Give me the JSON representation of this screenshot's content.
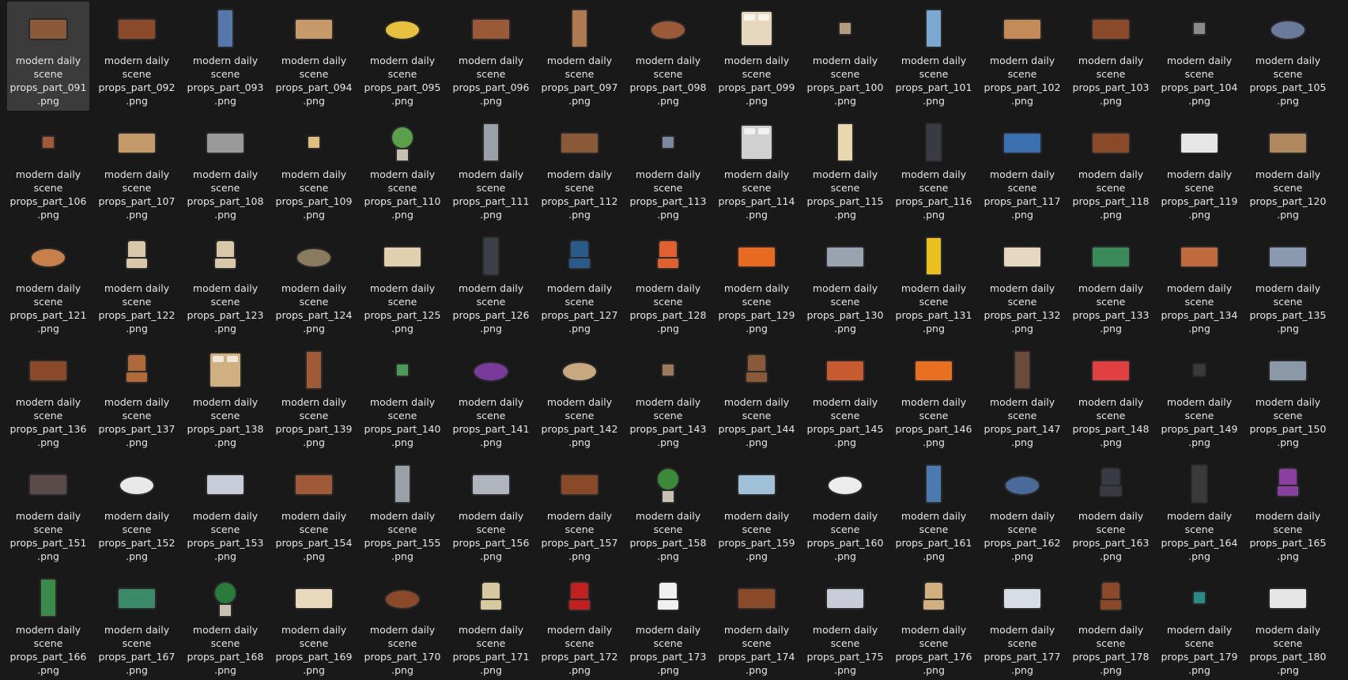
{
  "files": [
    {
      "name_line1": "modern daily",
      "name_line2": "scene",
      "name_line3": "props_part_091",
      "name_line4": ".png",
      "icon": "sofa-icon",
      "color": "#8a5a3a"
    },
    {
      "name_line1": "modern daily",
      "name_line2": "scene",
      "name_line3": "props_part_092",
      "name_line4": ".png",
      "icon": "bench-icon",
      "color": "#8a4a2a"
    },
    {
      "name_line1": "modern daily",
      "name_line2": "scene",
      "name_line3": "props_part_093",
      "name_line4": ".png",
      "icon": "parking-meter-icon",
      "color": "#5577aa"
    },
    {
      "name_line1": "modern daily",
      "name_line2": "scene",
      "name_line3": "props_part_094",
      "name_line4": ".png",
      "icon": "rug-icon",
      "color": "#c89a6a"
    },
    {
      "name_line1": "modern daily",
      "name_line2": "scene",
      "name_line3": "props_part_095",
      "name_line4": ".png",
      "icon": "stool-icon",
      "color": "#e8c040"
    },
    {
      "name_line1": "modern daily",
      "name_line2": "scene",
      "name_line3": "props_part_096",
      "name_line4": ".png",
      "icon": "dining-table-icon",
      "color": "#9a5a38"
    },
    {
      "name_line1": "modern daily",
      "name_line2": "scene",
      "name_line3": "props_part_097",
      "name_line4": ".png",
      "icon": "mirror-icon",
      "color": "#b07a50"
    },
    {
      "name_line1": "modern daily",
      "name_line2": "scene",
      "name_line3": "props_part_098",
      "name_line4": ".png",
      "icon": "round-table-icon",
      "color": "#9a5a38"
    },
    {
      "name_line1": "modern daily",
      "name_line2": "scene",
      "name_line3": "props_part_099",
      "name_line4": ".png",
      "icon": "bed-icon",
      "color": "#e6d8bc"
    },
    {
      "name_line1": "modern daily",
      "name_line2": "scene",
      "name_line3": "props_part_100",
      "name_line4": ".png",
      "icon": "nightstand-icon",
      "color": "#b49a80"
    },
    {
      "name_line1": "modern daily",
      "name_line2": "scene",
      "name_line3": "props_part_101",
      "name_line4": ".png",
      "icon": "standing-mirror-icon",
      "color": "#7aa8d0"
    },
    {
      "name_line1": "modern daily",
      "name_line2": "scene",
      "name_line3": "props_part_102",
      "name_line4": ".png",
      "icon": "vanity-icon",
      "color": "#c48a5a"
    },
    {
      "name_line1": "modern daily",
      "name_line2": "scene",
      "name_line3": "props_part_103",
      "name_line4": ".png",
      "icon": "dresser-icon",
      "color": "#8a4a2a"
    },
    {
      "name_line1": "modern daily",
      "name_line2": "scene",
      "name_line3": "props_part_104",
      "name_line4": ".png",
      "icon": "ottoman-icon",
      "color": "#8a8a8a"
    },
    {
      "name_line1": "modern daily",
      "name_line2": "scene",
      "name_line3": "props_part_105",
      "name_line4": ".png",
      "icon": "round-rug-icon",
      "color": "#6a7a9a"
    },
    {
      "name_line1": "modern daily",
      "name_line2": "scene",
      "name_line3": "props_part_106",
      "name_line4": ".png",
      "icon": "bedside-clock-icon",
      "color": "#a05a3a"
    },
    {
      "name_line1": "modern daily",
      "name_line2": "scene",
      "name_line3": "props_part_107",
      "name_line4": ".png",
      "icon": "desk-monitor-icon",
      "color": "#c49a6a"
    },
    {
      "name_line1": "modern daily",
      "name_line2": "scene",
      "name_line3": "props_part_108",
      "name_line4": ".png",
      "icon": "counter-icon",
      "color": "#9a9a9a"
    },
    {
      "name_line1": "modern daily",
      "name_line2": "scene",
      "name_line3": "props_part_109",
      "name_line4": ".png",
      "icon": "small-stool-icon",
      "color": "#e0c080"
    },
    {
      "name_line1": "modern daily",
      "name_line2": "scene",
      "name_line3": "props_part_110",
      "name_line4": ".png",
      "icon": "flower-box-icon",
      "color": "#5aa04a"
    },
    {
      "name_line1": "modern daily",
      "name_line2": "scene",
      "name_line3": "props_part_111",
      "name_line4": ".png",
      "icon": "heater-icon",
      "color": "#9aa0a8"
    },
    {
      "name_line1": "modern daily",
      "name_line2": "scene",
      "name_line3": "props_part_112",
      "name_line4": ".png",
      "icon": "cork-board-icon",
      "color": "#8a5a38"
    },
    {
      "name_line1": "modern daily",
      "name_line2": "scene",
      "name_line3": "props_part_113",
      "name_line4": ".png",
      "icon": "drawer-icon",
      "color": "#7a88a0"
    },
    {
      "name_line1": "modern daily",
      "name_line2": "scene",
      "name_line3": "props_part_114",
      "name_line4": ".png",
      "icon": "double-bed-icon",
      "color": "#d0d0d0"
    },
    {
      "name_line1": "modern daily",
      "name_line2": "scene",
      "name_line3": "props_part_115",
      "name_line4": ".png",
      "icon": "floor-lamp-icon",
      "color": "#e8d8b0"
    },
    {
      "name_line1": "modern daily",
      "name_line2": "scene",
      "name_line3": "props_part_116",
      "name_line4": ".png",
      "icon": "pc-tower-icon",
      "color": "#3a3a44"
    },
    {
      "name_line1": "modern daily",
      "name_line2": "scene",
      "name_line3": "props_part_117",
      "name_line4": ".png",
      "icon": "painting-icon",
      "color": "#3a70b0"
    },
    {
      "name_line1": "modern daily",
      "name_line2": "scene",
      "name_line3": "props_part_118",
      "name_line4": ".png",
      "icon": "tv-cabinet-icon",
      "color": "#8a4a2a"
    },
    {
      "name_line1": "modern daily",
      "name_line2": "scene",
      "name_line3": "props_part_119",
      "name_line4": ".png",
      "icon": "white-cabinet-icon",
      "color": "#e6e6e6"
    },
    {
      "name_line1": "modern daily",
      "name_line2": "scene",
      "name_line3": "props_part_120",
      "name_line4": ".png",
      "icon": "doormat-icon",
      "color": "#b08860"
    },
    {
      "name_line1": "modern daily",
      "name_line2": "scene",
      "name_line3": "props_part_121",
      "name_line4": ".png",
      "icon": "coffee-table-icon",
      "color": "#c8804a"
    },
    {
      "name_line1": "modern daily",
      "name_line2": "scene",
      "name_line3": "props_part_122",
      "name_line4": ".png",
      "icon": "armchair-icon",
      "color": "#d8c8a8"
    },
    {
      "name_line1": "modern daily",
      "name_line2": "scene",
      "name_line3": "props_part_123",
      "name_line4": ".png",
      "icon": "lounge-chair-icon",
      "color": "#d8c8a8"
    },
    {
      "name_line1": "modern daily",
      "name_line2": "scene",
      "name_line3": "props_part_124",
      "name_line4": ".png",
      "icon": "bean-bag-icon",
      "color": "#8a7a60"
    },
    {
      "name_line1": "modern daily",
      "name_line2": "scene",
      "name_line3": "props_part_125",
      "name_line4": ".png",
      "icon": "loveseat-icon",
      "color": "#e0d0b0"
    },
    {
      "name_line1": "modern daily",
      "name_line2": "scene",
      "name_line3": "props_part_126",
      "name_line4": ".png",
      "icon": "kiosk-icon",
      "color": "#3a3f48"
    },
    {
      "name_line1": "modern daily",
      "name_line2": "scene",
      "name_line3": "props_part_127",
      "name_line4": ".png",
      "icon": "egg-chair-icon",
      "color": "#2a5a8a"
    },
    {
      "name_line1": "modern daily",
      "name_line2": "scene",
      "name_line3": "props_part_128",
      "name_line4": ".png",
      "icon": "orange-chair-icon",
      "color": "#e06030"
    },
    {
      "name_line1": "modern daily",
      "name_line2": "scene",
      "name_line3": "props_part_129",
      "name_line4": ".png",
      "icon": "road-barrier-icon",
      "color": "#e86a20"
    },
    {
      "name_line1": "modern daily",
      "name_line2": "scene",
      "name_line3": "props_part_130",
      "name_line4": ".png",
      "icon": "electric-box-icon",
      "color": "#9aa4b0"
    },
    {
      "name_line1": "modern daily",
      "name_line2": "scene",
      "name_line3": "props_part_131",
      "name_line4": ".png",
      "icon": "bollard-icon",
      "color": "#e8c020"
    },
    {
      "name_line1": "modern daily",
      "name_line2": "scene",
      "name_line3": "props_part_132",
      "name_line4": ".png",
      "icon": "chaise-icon",
      "color": "#e6d8c0"
    },
    {
      "name_line1": "modern daily",
      "name_line2": "scene",
      "name_line3": "props_part_133",
      "name_line4": ".png",
      "icon": "green-sofa-icon",
      "color": "#3a8a5a"
    },
    {
      "name_line1": "modern daily",
      "name_line2": "scene",
      "name_line3": "props_part_134",
      "name_line4": ".png",
      "icon": "wall-art-icon",
      "color": "#c06a40"
    },
    {
      "name_line1": "modern daily",
      "name_line2": "scene",
      "name_line3": "props_part_135",
      "name_line4": ".png",
      "icon": "locker-icon",
      "color": "#8a98b0"
    },
    {
      "name_line1": "modern daily",
      "name_line2": "scene",
      "name_line3": "props_part_136",
      "name_line4": ".png",
      "icon": "bookshelf-icon",
      "color": "#8a4a2a"
    },
    {
      "name_line1": "modern daily",
      "name_line2": "scene",
      "name_line3": "props_part_137",
      "name_line4": ".png",
      "icon": "tufted-chair-icon",
      "color": "#b06a3a"
    },
    {
      "name_line1": "modern daily",
      "name_line2": "scene",
      "name_line3": "props_part_138",
      "name_line4": ".png",
      "icon": "wooden-bed-icon",
      "color": "#d0b080"
    },
    {
      "name_line1": "modern daily",
      "name_line2": "scene",
      "name_line3": "props_part_139",
      "name_line4": ".png",
      "icon": "wardrobe-icon",
      "color": "#a05a38"
    },
    {
      "name_line1": "modern daily",
      "name_line2": "scene",
      "name_line3": "props_part_140",
      "name_line4": ".png",
      "icon": "green-stool-icon",
      "color": "#4a9a5a"
    },
    {
      "name_line1": "modern daily",
      "name_line2": "scene",
      "name_line3": "props_part_141",
      "name_line4": ".png",
      "icon": "purple-pouf-icon",
      "color": "#7a3a9a"
    },
    {
      "name_line1": "modern daily",
      "name_line2": "scene",
      "name_line3": "props_part_142",
      "name_line4": ".png",
      "icon": "round-ottoman-icon",
      "color": "#c8a880"
    },
    {
      "name_line1": "modern daily",
      "name_line2": "scene",
      "name_line3": "props_part_143",
      "name_line4": ".png",
      "icon": "radio-icon",
      "color": "#9a7a58"
    },
    {
      "name_line1": "modern daily",
      "name_line2": "scene",
      "name_line3": "props_part_144",
      "name_line4": ".png",
      "icon": "wooden-chair-icon",
      "color": "#8a5a38"
    },
    {
      "name_line1": "modern daily",
      "name_line2": "scene",
      "name_line3": "props_part_145",
      "name_line4": ".png",
      "icon": "small-sofa-icon",
      "color": "#c85a30"
    },
    {
      "name_line1": "modern daily",
      "name_line2": "scene",
      "name_line3": "props_part_146",
      "name_line4": ".png",
      "icon": "orange-sofa-icon",
      "color": "#e87020"
    },
    {
      "name_line1": "modern daily",
      "name_line2": "scene",
      "name_line3": "props_part_147",
      "name_line4": ".png",
      "icon": "oval-mirror-icon",
      "color": "#6a4a3a"
    },
    {
      "name_line1": "modern daily",
      "name_line2": "scene",
      "name_line3": "props_part_148",
      "name_line4": ".png",
      "icon": "striped-barrier-icon",
      "color": "#e04040"
    },
    {
      "name_line1": "modern daily",
      "name_line2": "scene",
      "name_line3": "props_part_149",
      "name_line4": ".png",
      "icon": "tiny-chair-icon",
      "color": "#3a3a3a"
    },
    {
      "name_line1": "modern daily",
      "name_line2": "scene",
      "name_line3": "props_part_150",
      "name_line4": ".png",
      "icon": "safe-icon",
      "color": "#8a98a8"
    },
    {
      "name_line1": "modern daily",
      "name_line2": "scene",
      "name_line3": "props_part_151",
      "name_line4": ".png",
      "icon": "tv-stand-icon",
      "color": "#5a4a4a"
    },
    {
      "name_line1": "modern daily",
      "name_line2": "scene",
      "name_line3": "props_part_152",
      "name_line4": ".png",
      "icon": "marble-table-icon",
      "color": "#e8e8e8"
    },
    {
      "name_line1": "modern daily",
      "name_line2": "scene",
      "name_line3": "props_part_153",
      "name_line4": ".png",
      "icon": "bar-counter-icon",
      "color": "#c8ccd8"
    },
    {
      "name_line1": "modern daily",
      "name_line2": "scene",
      "name_line3": "props_part_154",
      "name_line4": ".png",
      "icon": "kitchen-sink-icon",
      "color": "#a05a38"
    },
    {
      "name_line1": "modern daily",
      "name_line2": "scene",
      "name_line3": "props_part_155",
      "name_line4": ".png",
      "icon": "bar-stool-icon",
      "color": "#9aa0a8"
    },
    {
      "name_line1": "modern daily",
      "name_line2": "scene",
      "name_line3": "props_part_156",
      "name_line4": ".png",
      "icon": "sectional-sofa-icon",
      "color": "#b0b4bc"
    },
    {
      "name_line1": "modern daily",
      "name_line2": "scene",
      "name_line3": "props_part_157",
      "name_line4": ".png",
      "icon": "media-console-icon",
      "color": "#8a4a2a"
    },
    {
      "name_line1": "modern daily",
      "name_line2": "scene",
      "name_line3": "props_part_158",
      "name_line4": ".png",
      "icon": "potted-plant-icon",
      "color": "#3a8a3a"
    },
    {
      "name_line1": "modern daily",
      "name_line2": "scene",
      "name_line3": "props_part_159",
      "name_line4": ".png",
      "icon": "ticket-machine-icon",
      "color": "#a0c0d8"
    },
    {
      "name_line1": "modern daily",
      "name_line2": "scene",
      "name_line3": "props_part_160",
      "name_line4": ".png",
      "icon": "white-table-icon",
      "color": "#ececec"
    },
    {
      "name_line1": "modern daily",
      "name_line2": "scene",
      "name_line3": "props_part_161",
      "name_line4": ".png",
      "icon": "bus-stop-sign-icon",
      "color": "#4a7ab0"
    },
    {
      "name_line1": "modern daily",
      "name_line2": "scene",
      "name_line3": "props_part_162",
      "name_line4": ".png",
      "icon": "blue-mat-icon",
      "color": "#4a6a9a"
    },
    {
      "name_line1": "modern daily",
      "name_line2": "scene",
      "name_line3": "props_part_163",
      "name_line4": ".png",
      "icon": "office-chair-icon",
      "color": "#3a3a44"
    },
    {
      "name_line1": "modern daily",
      "name_line2": "scene",
      "name_line3": "props_part_164",
      "name_line4": ".png",
      "icon": "street-lamp-icon",
      "color": "#3a3a3a"
    },
    {
      "name_line1": "modern daily",
      "name_line2": "scene",
      "name_line3": "props_part_165",
      "name_line4": ".png",
      "icon": "pod-chair-icon",
      "color": "#8a40a0"
    },
    {
      "name_line1": "modern daily",
      "name_line2": "scene",
      "name_line3": "props_part_166",
      "name_line4": ".png",
      "icon": "trash-can-icon",
      "color": "#3a8a4a"
    },
    {
      "name_line1": "modern daily",
      "name_line2": "scene",
      "name_line3": "props_part_167",
      "name_line4": ".png",
      "icon": "green-chaise-icon",
      "color": "#3a8a6a"
    },
    {
      "name_line1": "modern daily",
      "name_line2": "scene",
      "name_line3": "props_part_168",
      "name_line4": ".png",
      "icon": "planter-tree-icon",
      "color": "#2a7a3a"
    },
    {
      "name_line1": "modern daily",
      "name_line2": "scene",
      "name_line3": "props_part_169",
      "name_line4": ".png",
      "icon": "corner-sofa-icon",
      "color": "#e8d8bc"
    },
    {
      "name_line1": "modern daily",
      "name_line2": "scene",
      "name_line3": "props_part_170",
      "name_line4": ".png",
      "icon": "oval-table-icon",
      "color": "#8a4a2a"
    },
    {
      "name_line1": "modern daily",
      "name_line2": "scene",
      "name_line3": "props_part_171",
      "name_line4": ".png",
      "icon": "folding-chair-icon",
      "color": "#d8c8a0"
    },
    {
      "name_line1": "modern daily",
      "name_line2": "scene",
      "name_line3": "props_part_172",
      "name_line4": ".png",
      "icon": "gaming-chair-icon",
      "color": "#c02020"
    },
    {
      "name_line1": "modern daily",
      "name_line2": "scene",
      "name_line3": "props_part_173",
      "name_line4": ".png",
      "icon": "toilet-icon",
      "color": "#f0f0f0"
    },
    {
      "name_line1": "modern daily",
      "name_line2": "scene",
      "name_line3": "props_part_174",
      "name_line4": ".png",
      "icon": "tv-table-icon",
      "color": "#8a4a2a"
    },
    {
      "name_line1": "modern daily",
      "name_line2": "scene",
      "name_line3": "props_part_175",
      "name_line4": ".png",
      "icon": "stove-icon",
      "color": "#c8ccd8"
    },
    {
      "name_line1": "modern daily",
      "name_line2": "scene",
      "name_line3": "props_part_176",
      "name_line4": ".png",
      "icon": "dining-chair-icon",
      "color": "#d0b080"
    },
    {
      "name_line1": "modern daily",
      "name_line2": "scene",
      "name_line3": "props_part_177",
      "name_line4": ".png",
      "icon": "shelf-rack-icon",
      "color": "#d8dce4"
    },
    {
      "name_line1": "modern daily",
      "name_line2": "scene",
      "name_line3": "props_part_178",
      "name_line4": ".png",
      "icon": "leather-chair-icon",
      "color": "#8a4a2a"
    },
    {
      "name_line1": "modern daily",
      "name_line2": "scene",
      "name_line3": "props_part_179",
      "name_line4": ".png",
      "icon": "teal-stool-icon",
      "color": "#2a8a8a"
    },
    {
      "name_line1": "modern daily",
      "name_line2": "scene",
      "name_line3": "props_part_180",
      "name_line4": ".png",
      "icon": "computer-desk-icon",
      "color": "#e6e6e6"
    }
  ],
  "selected_index": 0,
  "colors": {
    "background": "#191919",
    "text": "#e6e6e6",
    "selection": "#3b3b3b"
  }
}
